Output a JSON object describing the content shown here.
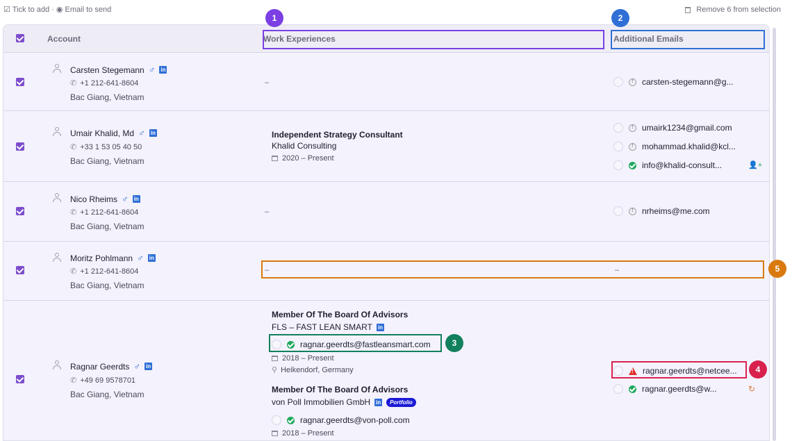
{
  "toolbar": {
    "hint": "☑ Tick to add · ◉ Email to send",
    "remove_label": "Remove 6 from selection"
  },
  "headers": {
    "account": "Account",
    "work": "Work Experiences",
    "emails": "Additional Emails"
  },
  "empty": "–",
  "rows": [
    {
      "name": "Carsten Stegemann",
      "phone": "+1 212-641-8604",
      "location": "Bac Giang, Vietnam",
      "emails": [
        {
          "text": "carsten-stegemann@g...",
          "status": "unknown"
        }
      ]
    },
    {
      "name": "Umair Khalid, Md",
      "phone": "+33 1 53 05 40 50",
      "location": "Bac Giang, Vietnam",
      "work": [
        {
          "title": "Independent Strategy Consultant",
          "company": "Khalid Consulting",
          "dates": "2020 – Present"
        }
      ],
      "emails": [
        {
          "text": "umairk1234@gmail.com",
          "status": "unknown"
        },
        {
          "text": "mohammad.khalid@kcl...",
          "status": "unknown"
        },
        {
          "text": "info@khalid-consult...",
          "status": "valid"
        }
      ]
    },
    {
      "name": "Nico Rheims",
      "phone": "+1 212-641-8604",
      "location": "Bac Giang, Vietnam",
      "emails": [
        {
          "text": "nrheims@me.com",
          "status": "unknown"
        }
      ]
    },
    {
      "name": "Moritz Pohlmann",
      "phone": "+1 212-641-8604",
      "location": "Bac Giang, Vietnam"
    },
    {
      "name": "Ragnar Geerdts",
      "phone": "+49 69 9578701",
      "location": "Bac Giang, Vietnam",
      "work": [
        {
          "title": "Member Of The Board Of Advisors",
          "company": "FLS – FAST LEAN SMART",
          "email": "ragnar.geerdts@fastleansmart.com",
          "dates": "2018 – Present",
          "location": "Heikendorf, Germany"
        },
        {
          "title": "Member Of The Board Of Advisors",
          "company": "von Poll Immobilien GmbH",
          "tag": "Portfolio",
          "email": "ragnar.geerdts@von-poll.com",
          "dates": "2018 – Present"
        }
      ],
      "emails": [
        {
          "text": "ragnar.geerdts@netcee...",
          "status": "warning"
        },
        {
          "text": "ragnar.geerdts@w...",
          "status": "valid"
        }
      ]
    }
  ],
  "annotations": [
    "1",
    "2",
    "3",
    "4",
    "5"
  ],
  "colors": {
    "accent": "#7c4dcc",
    "valid": "#1ea85c",
    "warning": "#e0322d",
    "linkedin": "#2f6fd6",
    "hl1": "#7b3fe4",
    "hl2": "#2f6fd6",
    "hl3": "#12805c",
    "hl4": "#d9214e",
    "hl5": "#d97a0f"
  }
}
